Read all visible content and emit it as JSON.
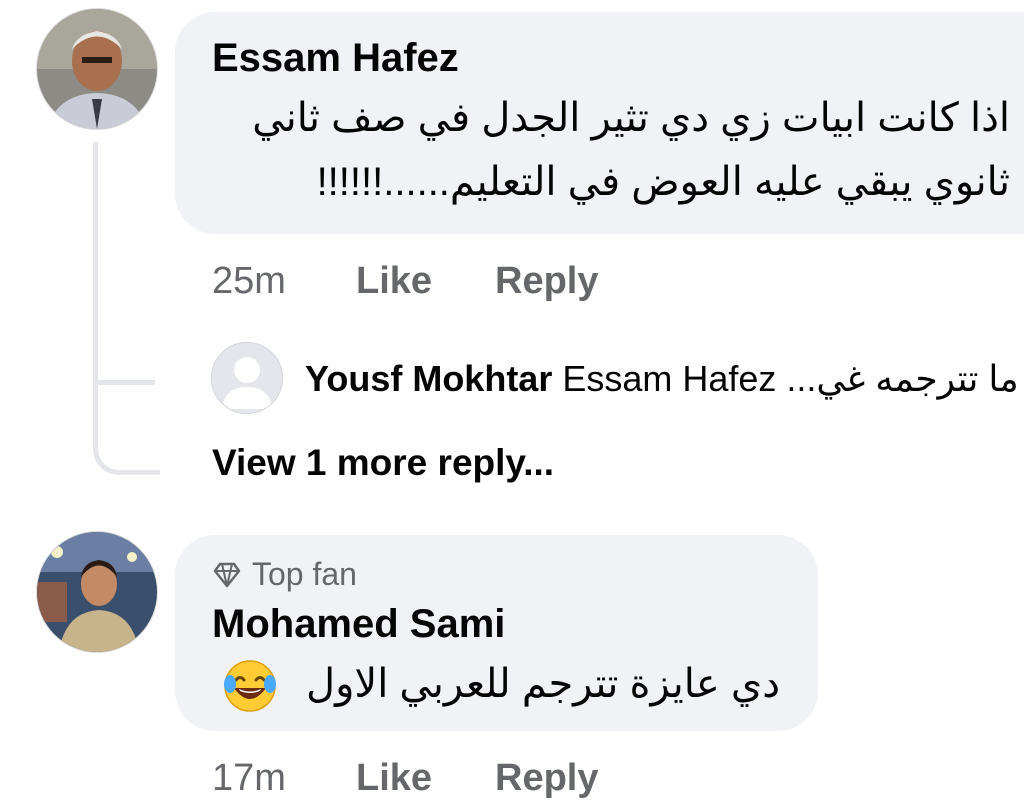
{
  "comments": [
    {
      "author": "Essam Hafez",
      "text_lines": [
        "اذا كانت ابيات زي دي تثير الجدل في صف ثاني",
        "ثانوي يبقي عليه العوض في التعليم......!!!!!!"
      ],
      "time": "25m",
      "like_label": "Like",
      "reply_label": "Reply",
      "reply_preview": {
        "author": "Yousf Mokhtar",
        "text": "Essam Hafez ...ما تترجمه غي"
      },
      "view_more_label": "View 1 more reply..."
    },
    {
      "badge_label": "Top fan",
      "author": "Mohamed Sami",
      "text": "دي عايزة تترجم للعربي الاول",
      "emoji": "face-with-tears-of-joy",
      "time": "17m",
      "like_label": "Like",
      "reply_label": "Reply"
    }
  ],
  "colors": {
    "bubble_bg": "#f0f2f5",
    "secondary_text": "#65676b",
    "thread_line": "#e4e6eb"
  }
}
